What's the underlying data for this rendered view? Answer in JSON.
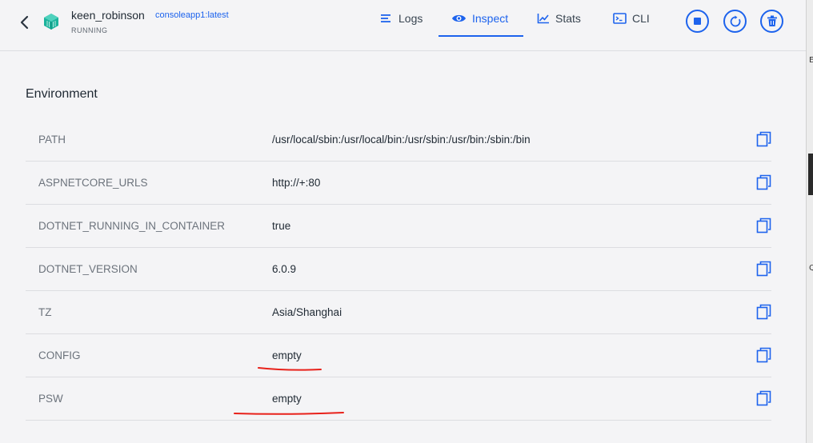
{
  "header": {
    "container_name": "keen_robinson",
    "image_name": "consoleapp1:latest",
    "status": "RUNNING",
    "tabs": [
      {
        "label": "Logs",
        "icon": "list-icon",
        "active": false
      },
      {
        "label": "Inspect",
        "icon": "eye-icon",
        "active": true
      },
      {
        "label": "Stats",
        "icon": "chart-icon",
        "active": false
      },
      {
        "label": "CLI",
        "icon": "terminal-icon",
        "active": false
      }
    ],
    "actions": [
      "stop-icon",
      "restart-icon",
      "trash-icon"
    ]
  },
  "side_marks": [
    "E",
    "Q"
  ],
  "environment": {
    "title": "Environment",
    "rows": [
      {
        "key": "PATH",
        "value": "/usr/local/sbin:/usr/local/bin:/usr/sbin:/usr/bin:/sbin:/bin"
      },
      {
        "key": "ASPNETCORE_URLS",
        "value": "http://+:80"
      },
      {
        "key": "DOTNET_RUNNING_IN_CONTAINER",
        "value": "true"
      },
      {
        "key": "DOTNET_VERSION",
        "value": "6.0.9"
      },
      {
        "key": "TZ",
        "value": "Asia/Shanghai"
      },
      {
        "key": "CONFIG",
        "value": "empty"
      },
      {
        "key": "PSW",
        "value": "empty"
      }
    ]
  },
  "colors": {
    "accent": "#1d63ed",
    "container_icon": "#1bb39c",
    "annotation": "#e8211a"
  }
}
